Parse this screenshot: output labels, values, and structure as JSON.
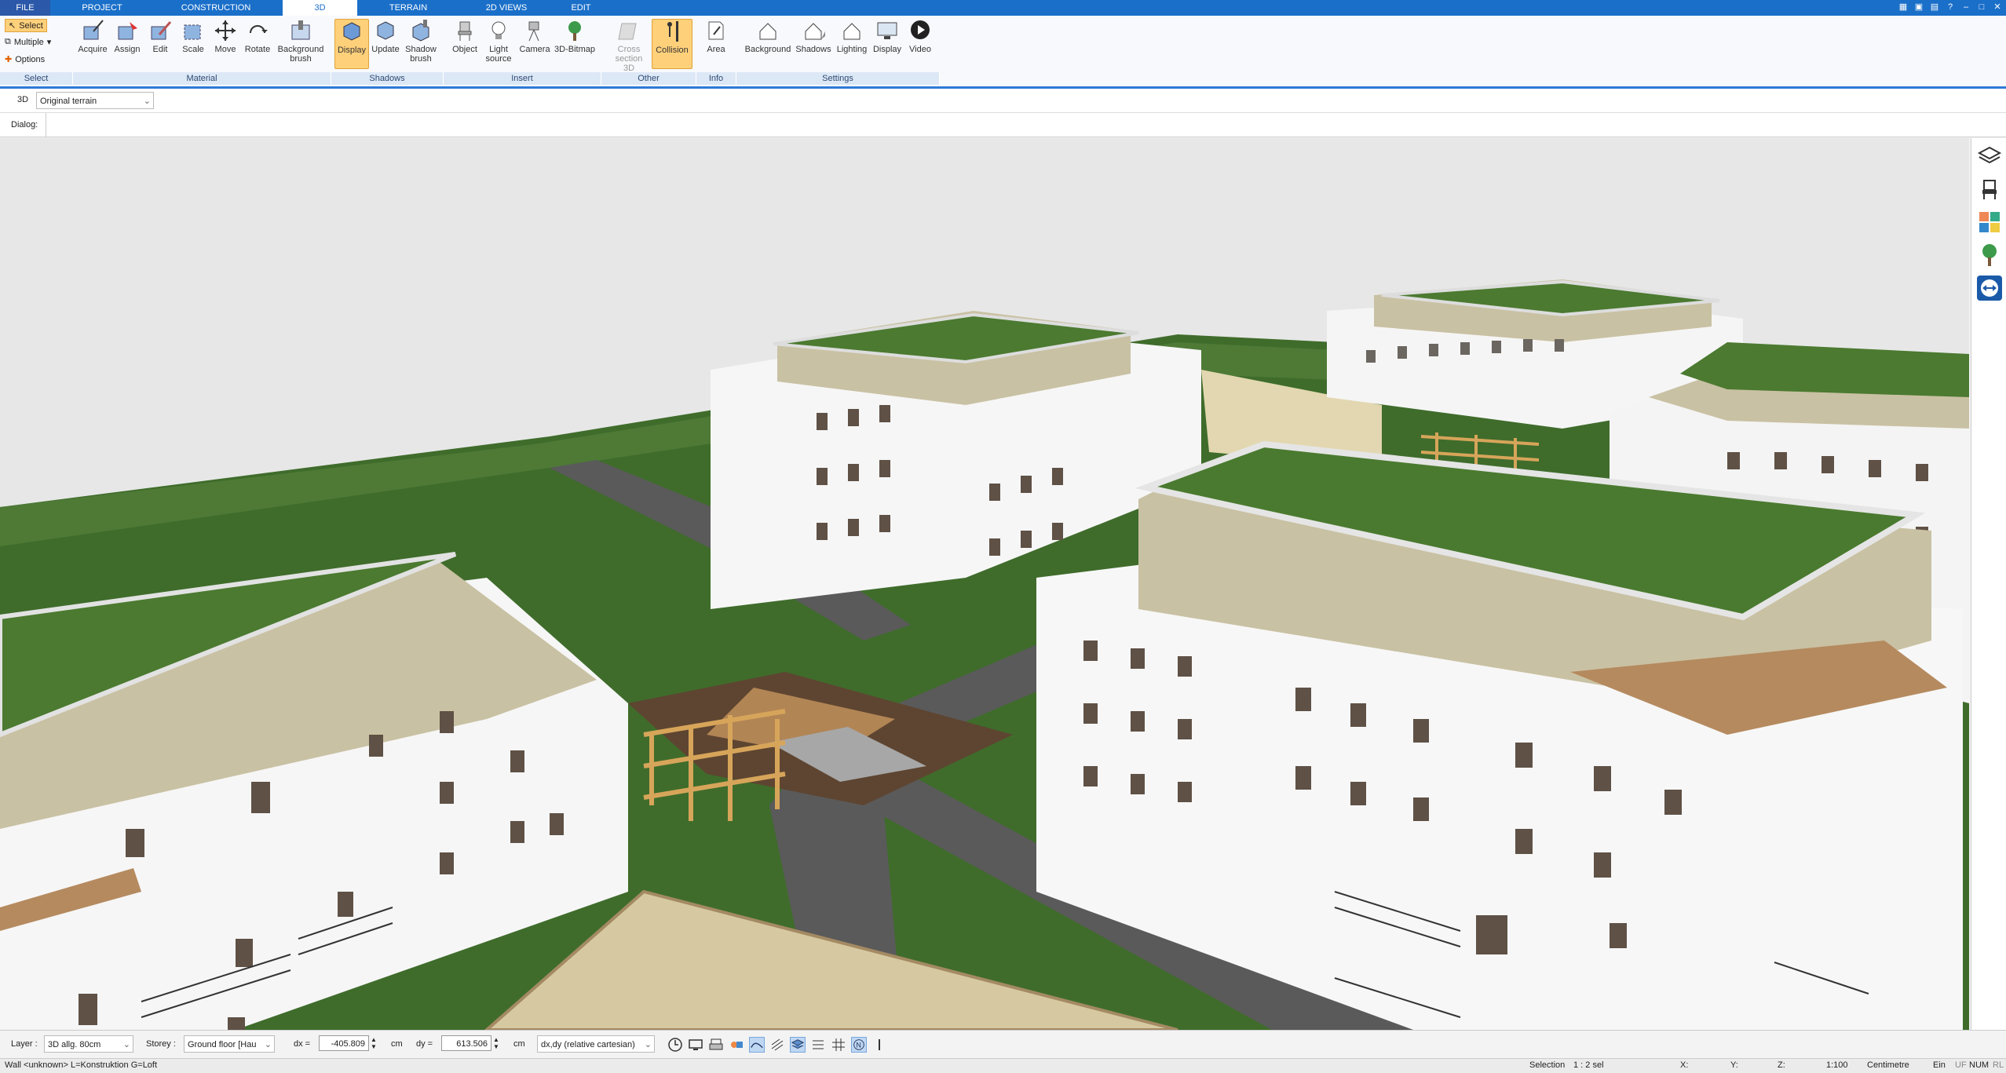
{
  "tabs": [
    "FILE",
    "PROJECT",
    "CONSTRUCTION",
    "3D",
    "TERRAIN",
    "2D VIEWS",
    "EDIT"
  ],
  "ribbon": {
    "select": {
      "select": "Select",
      "multiple": "Multiple",
      "options": "Options"
    },
    "material": [
      "Acquire",
      "Assign",
      "Edit",
      "Scale",
      "Move",
      "Rotate",
      "Background",
      "brush"
    ],
    "shadows": [
      "Display",
      "Update",
      "Shadow",
      "brush"
    ],
    "insert": [
      "Object",
      "Light",
      "source",
      "Camera",
      "3D-Bitmap"
    ],
    "other": [
      "Cross",
      "section 3D",
      "Collision"
    ],
    "info": [
      "Area"
    ],
    "settings": [
      "Background",
      "Shadows",
      "Lighting",
      "Display",
      "Video"
    ],
    "groups": [
      "Select",
      "Material",
      "Shadows",
      "Insert",
      "Other",
      "Info",
      "Settings"
    ]
  },
  "view": {
    "mode": "3D",
    "terrain": "Original terrain",
    "dialog": "Dialog:"
  },
  "bottom": {
    "layer_label": "Layer :",
    "layer_value": "3D allg. 80cm",
    "storey_label": "Storey :",
    "storey_value": "Ground floor [Hau",
    "dx_label": "dx =",
    "dx_value": "-405.809",
    "unit1": "cm",
    "dy_label": "dy =",
    "dy_value": "613.506",
    "unit2": "cm",
    "coord_mode": "dx,dy (relative cartesian)"
  },
  "status": {
    "wall": "Wall <unknown> L=Konstruktion G=Loft",
    "selection": "Selection",
    "sel_value": "1 : 2 sel",
    "x": "X:",
    "y": "Y:",
    "z": "Z:",
    "scale": "1:100",
    "unit": "Centimetre",
    "ein": "Ein",
    "uf": "UF",
    "num": "NUM",
    "rl": "RL"
  },
  "colors": {
    "accent": "#1a6fc9",
    "grass": "#3e6b2a",
    "roof": "#4d7a31",
    "facade": "#f5f5f5",
    "cladding": "#c9c1a3",
    "wood": "#b58a55",
    "path": "#5a5a5a"
  }
}
